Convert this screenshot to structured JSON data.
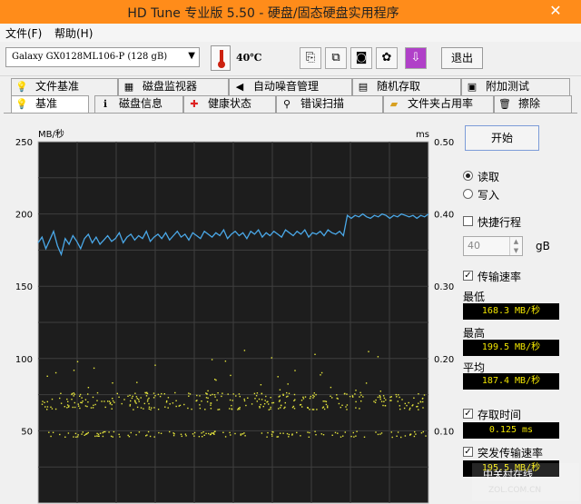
{
  "window": {
    "title": "HD Tune 专业版 5.50 - 硬盘/固态硬盘实用程序",
    "close": "✕"
  },
  "menu": {
    "file": "文件(F)",
    "help": "帮助(H)"
  },
  "toolbar": {
    "drive": "Galaxy GX0128ML106-P (128 gB)",
    "temperature": "40℃",
    "exit_label": "退出",
    "icons": [
      "copy-icon",
      "copy-all-icon",
      "camera-icon",
      "settings-icon",
      "download-icon"
    ]
  },
  "tabs_top": [
    {
      "label": "文件基准",
      "icon": "file-benchmark-icon"
    },
    {
      "label": "磁盘监视器",
      "icon": "disk-monitor-icon"
    },
    {
      "label": "自动噪音管理",
      "icon": "speaker-icon"
    },
    {
      "label": "随机存取",
      "icon": "random-access-icon"
    },
    {
      "label": "附加测试",
      "icon": "extra-tests-icon"
    }
  ],
  "tabs_bottom": [
    {
      "label": "基准",
      "icon": "benchmark-icon"
    },
    {
      "label": "磁盘信息",
      "icon": "info-icon"
    },
    {
      "label": "健康状态",
      "icon": "health-icon"
    },
    {
      "label": "错误扫描",
      "icon": "scan-icon"
    },
    {
      "label": "文件夹占用率",
      "icon": "folder-icon"
    },
    {
      "label": "擦除",
      "icon": "erase-icon"
    }
  ],
  "controls": {
    "start": "开始",
    "read": "读取",
    "write": "写入",
    "short_stroke": "快捷行程",
    "stroke_value": "40",
    "stroke_unit": "gB",
    "transfer_rate": "传输速率",
    "min_label": "最低",
    "min_value": "168.3 MB/秒",
    "max_label": "最高",
    "max_value": "199.5 MB/秒",
    "avg_label": "平均",
    "avg_value": "187.4 MB/秒",
    "access_time": "存取时间",
    "access_value": "0.125 ms",
    "burst_rate": "突发传输速率",
    "burst_value": "195.5 MB/秒"
  },
  "watermark": {
    "line1": "中关村在线",
    "line2": "ZOL.COM.CN"
  },
  "chart_data": {
    "type": "line",
    "ylabel_left": "MB/秒",
    "ylabel_right": "ms",
    "left_ticks": [
      "250",
      "200",
      "150",
      "100",
      "50"
    ],
    "right_ticks": [
      "0.50",
      "0.40",
      "0.30",
      "0.20",
      "0.10"
    ],
    "ylim_left": [
      0,
      250
    ],
    "ylim_right": [
      0,
      0.5
    ],
    "grid": true,
    "series": [
      {
        "color": "#4aa8e8",
        "values": [
          180,
          184,
          176,
          182,
          188,
          178,
          172,
          183,
          179,
          185,
          181,
          176,
          183,
          186,
          180,
          184,
          179,
          182,
          185,
          181,
          183,
          187,
          180,
          184,
          186,
          182,
          185,
          183,
          188,
          181,
          184,
          186,
          183,
          187,
          182,
          185,
          188,
          184,
          186,
          182,
          187,
          185,
          183,
          188,
          186,
          184,
          187,
          185,
          189,
          183,
          186,
          188,
          185,
          187,
          183,
          188,
          186,
          189,
          184,
          187,
          185,
          188,
          186,
          184,
          189,
          187,
          185,
          188,
          186,
          189,
          184,
          187,
          186,
          188,
          185,
          189,
          187,
          186,
          188,
          185,
          199,
          197,
          199,
          198,
          200,
          198,
          197,
          199,
          198,
          200,
          199,
          197,
          199,
          198,
          200,
          199,
          198,
          199,
          197,
          199,
          198,
          200
        ]
      }
    ],
    "scatter_bands": [
      {
        "color": "#e6e63c",
        "ms_center": 0.142,
        "ms_spread": 0.012,
        "ms_outlier_max": 0.215
      },
      {
        "color": "#e6e63c",
        "ms_center": 0.096,
        "ms_spread": 0.004,
        "ms_outlier_max": 0.1
      }
    ]
  }
}
